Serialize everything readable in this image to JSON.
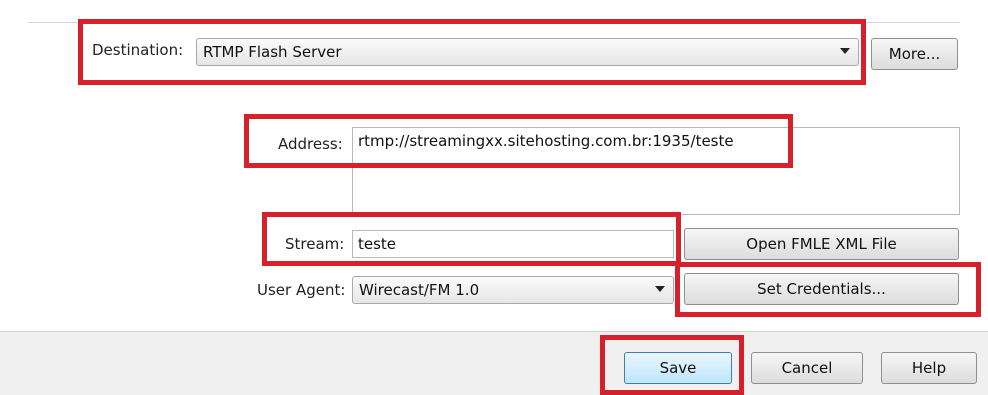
{
  "destination": {
    "label": "Destination:",
    "value": "RTMP Flash Server",
    "more_label": "More..."
  },
  "address": {
    "label": "Address:",
    "value": "rtmp://streamingxx.sitehosting.com.br:1935/teste"
  },
  "stream": {
    "label": "Stream:",
    "value": "teste",
    "open_xml_label": "Open FMLE XML File"
  },
  "user_agent": {
    "label": "User Agent:",
    "value": "Wirecast/FM 1.0",
    "set_credentials_label": "Set Credentials..."
  },
  "footer": {
    "save_label": "Save",
    "cancel_label": "Cancel",
    "help_label": "Help"
  },
  "colors": {
    "highlight": "#d6202b",
    "primary_button": "#bee6fd"
  }
}
